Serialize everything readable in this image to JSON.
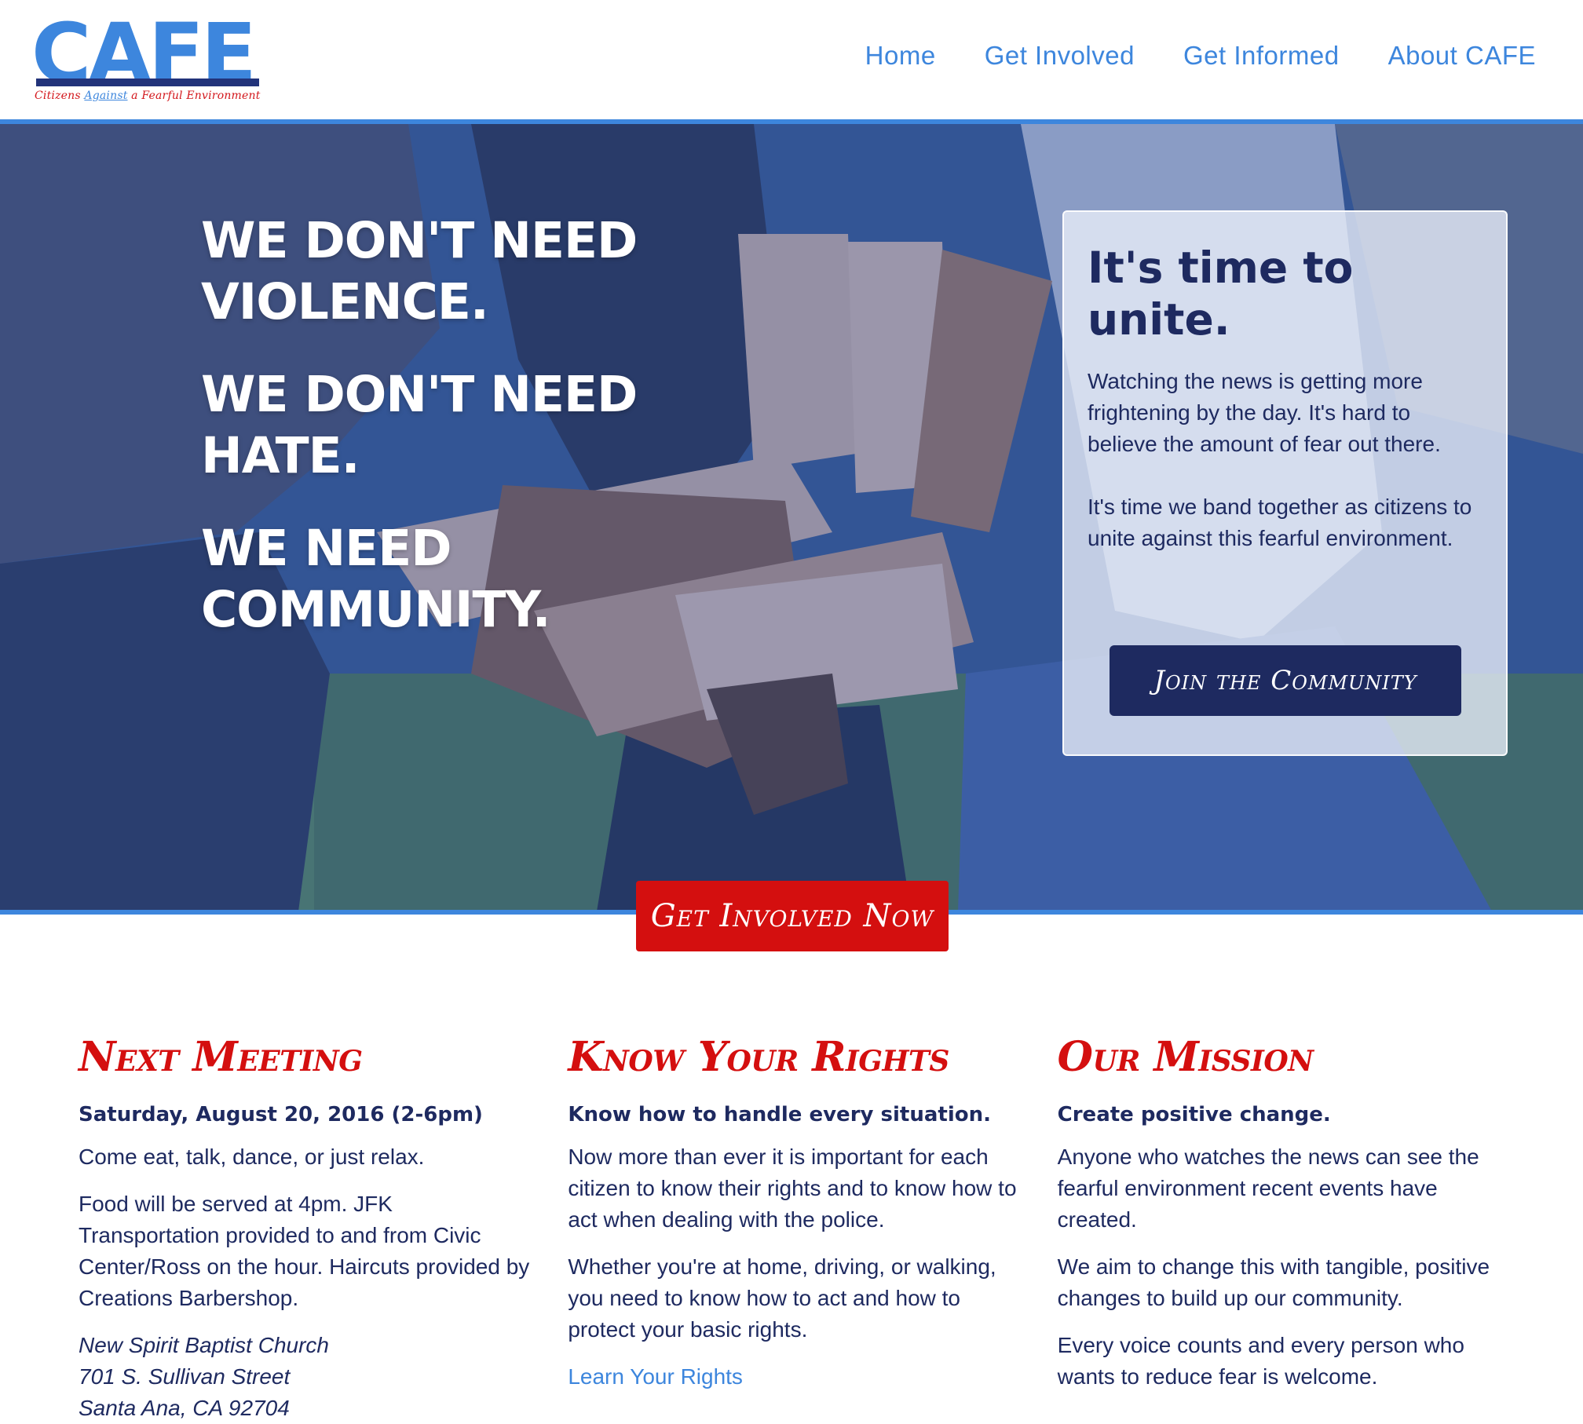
{
  "header": {
    "logo_text": "CAFE",
    "logo_tagline_start": "Citizens ",
    "logo_tagline_mid": "Against",
    "logo_tagline_end": " a Fearful Environment",
    "nav": [
      "Home",
      "Get Involved",
      "Get Informed",
      "About CAFE"
    ]
  },
  "hero": {
    "slogans": [
      "WE DON'T NEED VIOLENCE.",
      "WE DON'T NEED HATE.",
      "WE NEED COMMUNITY."
    ],
    "card": {
      "title": "It's time to unite.",
      "p1": "Watching the news is getting more frightening by the day. It's hard to believe the amount of fear out there.",
      "p2": "It's time we band together as citizens to unite against this fearful environment.",
      "button": "Join the Community"
    },
    "cta": "Get Involved Now"
  },
  "columns": {
    "meeting": {
      "title": "Next Meeting",
      "subtitle": "Saturday, August 20, 2016 (2-6pm)",
      "p1": "Come eat, talk, dance, or just relax.",
      "p2": "Food will be served at 4pm. JFK Transportation provided to and from Civic Center/Ross on the hour. Haircuts provided by Creations Barbershop.",
      "address": [
        "New Spirit Baptist Church",
        "701 S. Sullivan Street",
        "Santa Ana, CA 92704"
      ]
    },
    "rights": {
      "title": "Know Your Rights",
      "subtitle": "Know how to handle every situation.",
      "p1": "Now more than ever it is important for each citizen to know their rights and to know how to act when dealing with the police.",
      "p2": "Whether you're at home, driving, or walking, you need to know how to act and how to protect your basic rights.",
      "link": "Learn Your Rights"
    },
    "mission": {
      "title": "Our Mission",
      "subtitle": "Create positive change.",
      "p1": "Anyone who watches the news can see the fearful environment recent events have created.",
      "p2": "We aim to change this with tangible, positive changes to build up our community.",
      "p3": "Every voice counts and every person who wants to reduce fear is welcome."
    }
  },
  "colors": {
    "brand_blue": "#3d86dd",
    "navy": "#1e2a60",
    "red": "#d40f0f"
  }
}
